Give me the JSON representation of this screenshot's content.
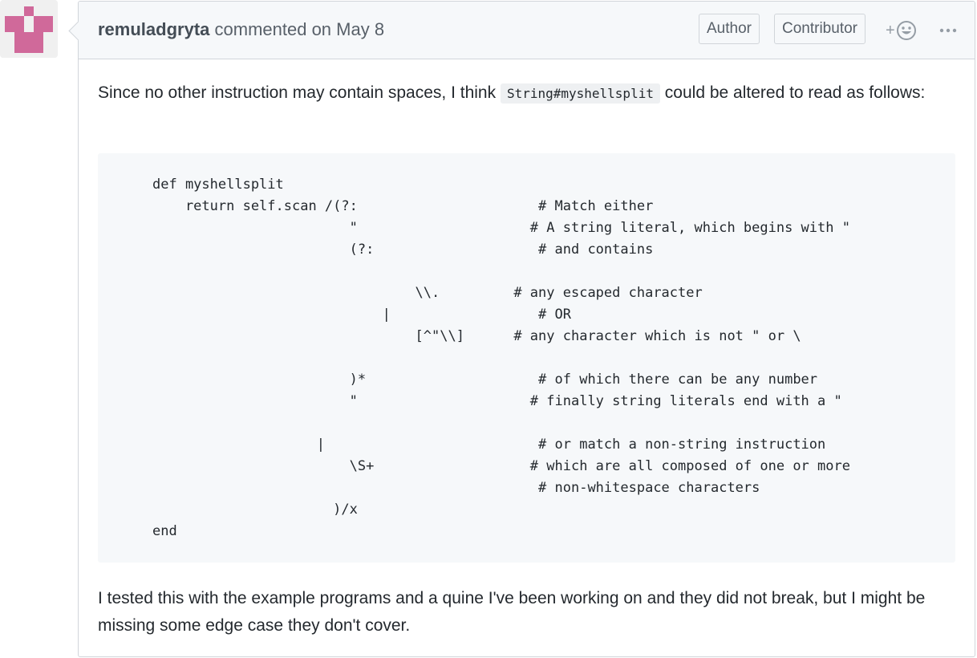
{
  "comment": {
    "author": "remuladgryta",
    "action_text": "commented on May 8",
    "labels": [
      "Author",
      "Contributor"
    ],
    "reaction_plus": "+",
    "more_icon": "kebab-horizontal-icon",
    "body": {
      "para1_before": "Since no other instruction may contain spaces, I think ",
      "para1_code": "String#myshellsplit",
      "para1_after": " could be altered to read as follows:",
      "code_lines": [
        "def myshellsplit",
        "    return self.scan /(?:                      # Match either",
        "                        \"                     # A string literal, which begins with \"",
        "                        (?:                    # and contains",
        "",
        "                                \\\\.         # any escaped character",
        "                            |                  # OR",
        "                                [^\"\\\\]      # any character which is not \" or \\",
        "",
        "                        )*                     # of which there can be any number",
        "                        \"                     # finally string literals end with a \"",
        "",
        "                    |                          # or match a non-string instruction",
        "                        \\S+                   # which are all composed of one or more",
        "                                               # non-whitespace characters",
        "                      )/x",
        "end"
      ],
      "para2": "I tested this with the example programs and a quine I've been working on and they did not break, but I might be missing some edge case they don't cover."
    }
  },
  "colors": {
    "border": "#d1d5da",
    "header_bg": "#f6f8fa",
    "code_bg": "#f6f8fa",
    "avatar_pink": "#d0699a",
    "muted_text": "#586069"
  }
}
